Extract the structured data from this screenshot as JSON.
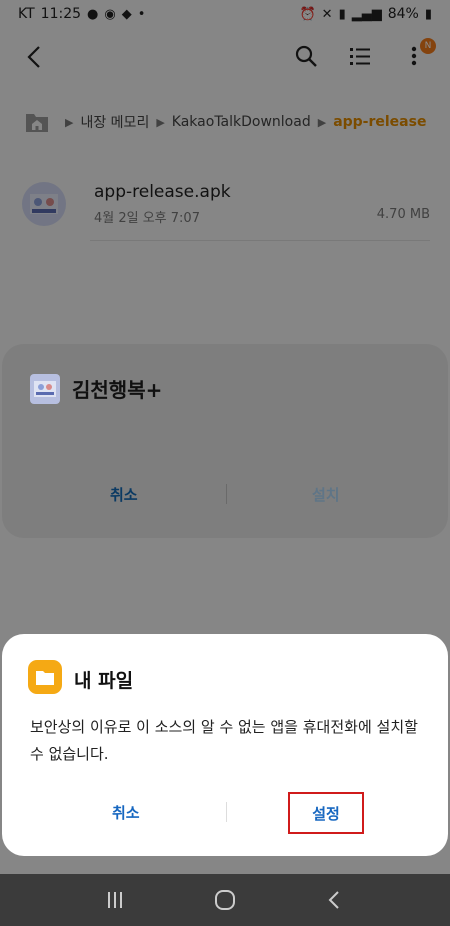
{
  "status_bar": {
    "carrier": "KT",
    "time": "11:25",
    "battery": "84%"
  },
  "breadcrumb": {
    "items": [
      "내장 메모리",
      "KakaoTalkDownload",
      "app-release"
    ]
  },
  "file": {
    "name": "app-release.apk",
    "date": "4월 2일 오후 7:07",
    "size": "4.70 MB"
  },
  "install_dialog": {
    "app_name": "김천행복+",
    "cancel_label": "취소",
    "install_label": "설치"
  },
  "security_dialog": {
    "title": "내 파일",
    "message": "보안상의 이유로 이 소스의 알 수 없는 앱을 휴대전화에 설치할 수 없습니다.",
    "cancel_label": "취소",
    "settings_label": "설정"
  },
  "colors": {
    "accent_orange": "#e08a00",
    "dialog_button_blue": "#1767c0",
    "highlight_red": "#d01b1b"
  }
}
